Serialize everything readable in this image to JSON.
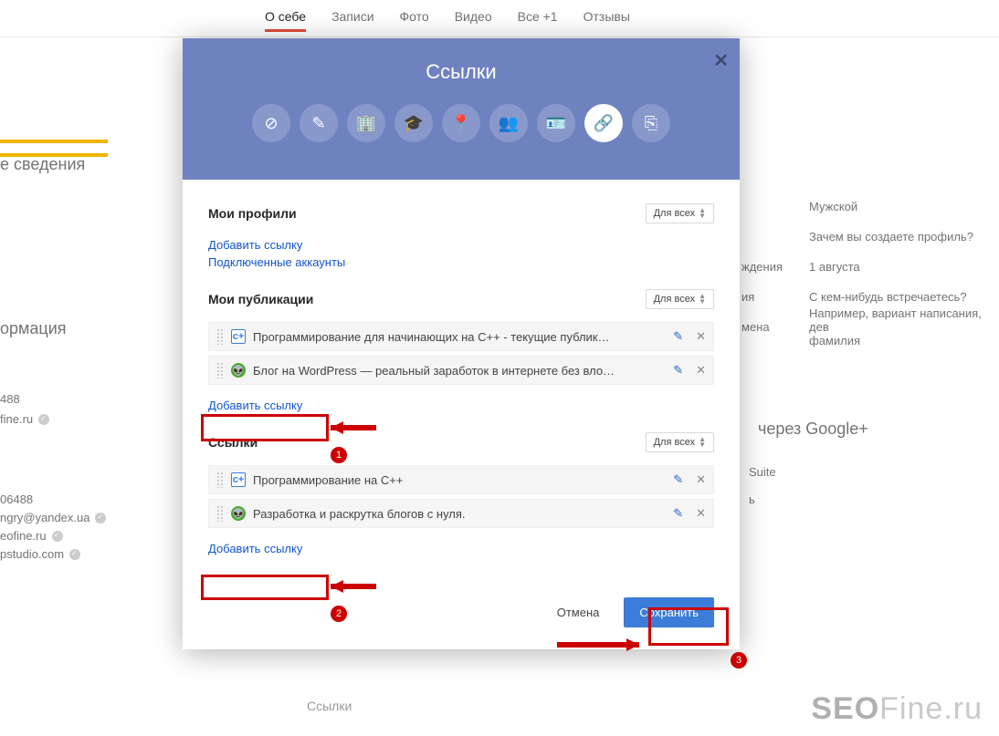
{
  "nav": {
    "tabs": [
      "О себе",
      "Записи",
      "Фото",
      "Видео",
      "Все +1",
      "Отзывы"
    ],
    "active_index": 0
  },
  "background": {
    "info_heading": "ормация",
    "info_heading_right": "е сведения",
    "phone": "488",
    "site": "fine.ru",
    "right_labels": [
      "",
      "",
      "ждения",
      "ия",
      "мена"
    ],
    "right_values": [
      "Мужской",
      "Зачем вы создаете профиль?",
      "1 августа",
      "С кем-нибудь встречаетесь?",
      "Например, вариант написания, дев\nфамилия"
    ],
    "contacts_heading_phone": "06488",
    "contacts_emails": [
      "ngry@yandex.ua",
      "eofine.ru",
      "pstudio.com"
    ],
    "gplus_heading": "через Google+",
    "gplus_items": [
      "Suite",
      "ь"
    ],
    "links_bottom_label": "Ссылки"
  },
  "modal": {
    "title": "Ссылки",
    "icons": [
      "link-icon",
      "pencil-icon",
      "building-icon",
      "graduation-icon",
      "pin-icon",
      "people-icon",
      "id-card-icon",
      "chain-icon",
      "translate-icon"
    ],
    "active_icon": 7,
    "sections": {
      "profiles": {
        "title": "Мои профили",
        "visibility": "Для всех",
        "add_link": "Добавить ссылку",
        "connected": "Подключенные аккаунты"
      },
      "publications": {
        "title": "Мои публикации",
        "visibility": "Для всех",
        "items": [
          {
            "favicon": "cpp",
            "text": "Программирование для начинающих на C++ - текущие публик…"
          },
          {
            "favicon": "alien",
            "text": "Блог на WordPress — реальный заработок в интернете без вло…"
          }
        ],
        "add_link": "Добавить ссылку"
      },
      "links": {
        "title": "Ссылки",
        "visibility": "Для всех",
        "items": [
          {
            "favicon": "cpp",
            "text": "Программирование на C++"
          },
          {
            "favicon": "alien",
            "text": "Разработка и раскрутка блогов с нуля."
          }
        ],
        "add_link": "Добавить ссылку"
      }
    },
    "footer": {
      "cancel": "Отмена",
      "save": "Сохранить"
    }
  },
  "annotations": {
    "n1": "1",
    "n2": "2",
    "n3": "3"
  },
  "watermark": {
    "bold": "SEO",
    "rest": "Fine.ru"
  }
}
